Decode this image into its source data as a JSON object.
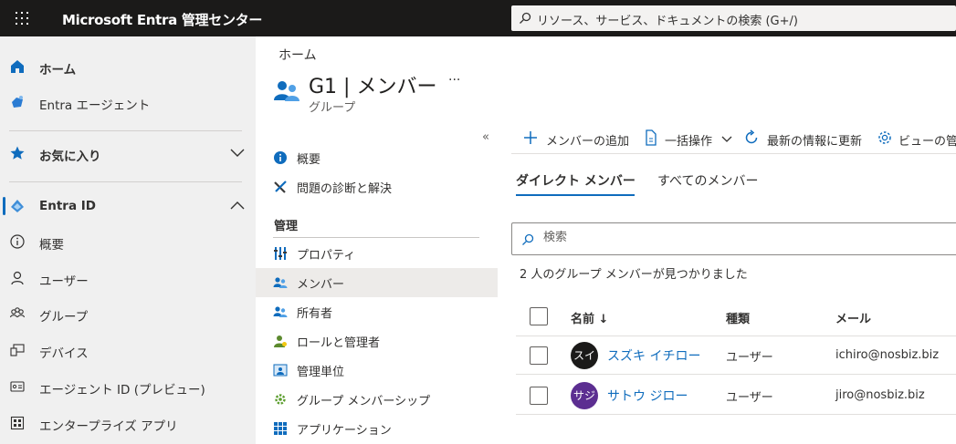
{
  "topbar": {
    "app_title": "Microsoft Entra 管理センター",
    "search_placeholder": "リソース、サービス、ドキュメントの検索 (G+/)"
  },
  "leftnav": {
    "items": [
      {
        "label": "ホーム",
        "icon": "home-icon"
      },
      {
        "label": "Entra エージェント",
        "icon": "agent-icon"
      },
      {
        "label": "お気に入り",
        "icon": "star-icon"
      },
      {
        "label": "Entra ID",
        "icon": "entra-id-icon"
      },
      {
        "label": "概要",
        "icon": "info-icon"
      },
      {
        "label": "ユーザー",
        "icon": "user-icon"
      },
      {
        "label": "グループ",
        "icon": "group-icon"
      },
      {
        "label": "デバイス",
        "icon": "device-icon"
      },
      {
        "label": "エージェント ID (プレビュー)",
        "icon": "id-card-icon"
      },
      {
        "label": "エンタープライズ アプリ",
        "icon": "apps-icon"
      }
    ]
  },
  "page": {
    "breadcrumb": "ホーム",
    "title": "G1 | メンバー",
    "subtitle": "グループ",
    "more": "···",
    "collapse": "«"
  },
  "resource_menu": {
    "items_top": [
      {
        "label": "概要",
        "icon": "info-icon"
      },
      {
        "label": "問題の診断と解決",
        "icon": "wrench-icon"
      }
    ],
    "section_title": "管理",
    "items_manage": [
      {
        "label": "プロパティ",
        "icon": "properties-icon"
      },
      {
        "label": "メンバー",
        "icon": "members-icon"
      },
      {
        "label": "所有者",
        "icon": "owners-icon"
      },
      {
        "label": "ロールと管理者",
        "icon": "roles-icon"
      },
      {
        "label": "管理単位",
        "icon": "admin-units-icon"
      },
      {
        "label": "グループ メンバーシップ",
        "icon": "group-membership-icon"
      },
      {
        "label": "アプリケーション",
        "icon": "applications-icon"
      }
    ]
  },
  "commands": {
    "add": "メンバーの追加",
    "bulk": "一括操作",
    "refresh": "最新の情報に更新",
    "view": "ビューの管"
  },
  "tabs": [
    "ダイレクト メンバー",
    "すべてのメンバー"
  ],
  "search": {
    "placeholder": "検索"
  },
  "result_text": "2 人のグループ メンバーが見つかりました",
  "table": {
    "columns": [
      "名前 ↓",
      "種類",
      "メール"
    ],
    "rows": [
      {
        "initials": "スイ",
        "name": "スズキ イチロー",
        "type": "ユーザー",
        "email": "ichiro@nosbiz.biz",
        "avatar_color": "#1b1a19"
      },
      {
        "initials": "サジ",
        "name": "サトウ ジロー",
        "type": "ユーザー",
        "email": "jiro@nosbiz.biz",
        "avatar_color": "#5c2e91"
      }
    ]
  }
}
